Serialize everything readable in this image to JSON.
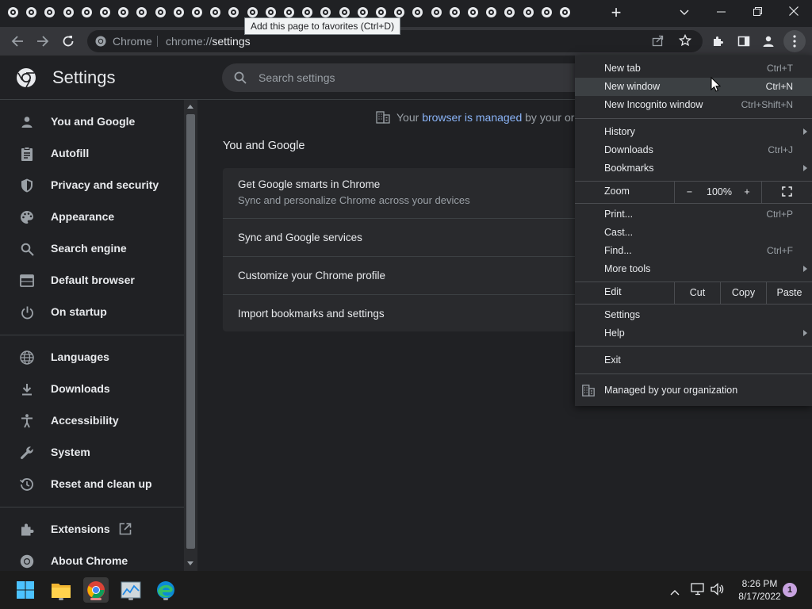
{
  "tooltip": "Add this page to favorites (Ctrl+D)",
  "omnibox": {
    "site": "Chrome",
    "url_scheme": "chrome://",
    "url_path": "settings"
  },
  "header": {
    "title": "Settings",
    "search_placeholder": "Search settings"
  },
  "sidebar": {
    "items": [
      {
        "label": "You and Google",
        "icon": "person-icon"
      },
      {
        "label": "Autofill",
        "icon": "clipboard-icon"
      },
      {
        "label": "Privacy and security",
        "icon": "shield-icon"
      },
      {
        "label": "Appearance",
        "icon": "palette-icon"
      },
      {
        "label": "Search engine",
        "icon": "search-icon"
      },
      {
        "label": "Default browser",
        "icon": "browser-window-icon"
      },
      {
        "label": "On startup",
        "icon": "power-icon"
      },
      {
        "label": "Languages",
        "icon": "globe-icon"
      },
      {
        "label": "Downloads",
        "icon": "download-icon"
      },
      {
        "label": "Accessibility",
        "icon": "accessibility-icon"
      },
      {
        "label": "System",
        "icon": "wrench-icon"
      },
      {
        "label": "Reset and clean up",
        "icon": "history-icon"
      },
      {
        "label": "Extensions",
        "icon": "puzzle-icon"
      },
      {
        "label": "About Chrome",
        "icon": "chrome-icon"
      }
    ]
  },
  "main": {
    "managed_prefix": "Your ",
    "managed_link": "browser is managed",
    "managed_suffix": " by your orga",
    "section_title": "You and Google",
    "card": [
      {
        "title": "Get Google smarts in Chrome",
        "subtitle": "Sync and personalize Chrome across your devices"
      },
      {
        "title": "Sync and Google services"
      },
      {
        "title": "Customize your Chrome profile"
      },
      {
        "title": "Import bookmarks and settings"
      }
    ]
  },
  "menu": {
    "new_tab": {
      "label": "New tab",
      "shortcut": "Ctrl+T"
    },
    "new_window": {
      "label": "New window",
      "shortcut": "Ctrl+N"
    },
    "new_incognito": {
      "label": "New Incognito window",
      "shortcut": "Ctrl+Shift+N"
    },
    "history": {
      "label": "History"
    },
    "downloads": {
      "label": "Downloads",
      "shortcut": "Ctrl+J"
    },
    "bookmarks": {
      "label": "Bookmarks"
    },
    "zoom": {
      "label": "Zoom",
      "minus": "−",
      "value": "100%",
      "plus": "+"
    },
    "print": {
      "label": "Print...",
      "shortcut": "Ctrl+P"
    },
    "cast": {
      "label": "Cast..."
    },
    "find": {
      "label": "Find...",
      "shortcut": "Ctrl+F"
    },
    "more_tools": {
      "label": "More tools"
    },
    "edit": {
      "label": "Edit",
      "cut": "Cut",
      "copy": "Copy",
      "paste": "Paste"
    },
    "settings": {
      "label": "Settings"
    },
    "help": {
      "label": "Help"
    },
    "exit": {
      "label": "Exit"
    },
    "managed": {
      "label": "Managed by your organization"
    }
  },
  "taskbar": {
    "time": "8:26 PM",
    "date": "8/17/2022",
    "notifications": "1"
  }
}
